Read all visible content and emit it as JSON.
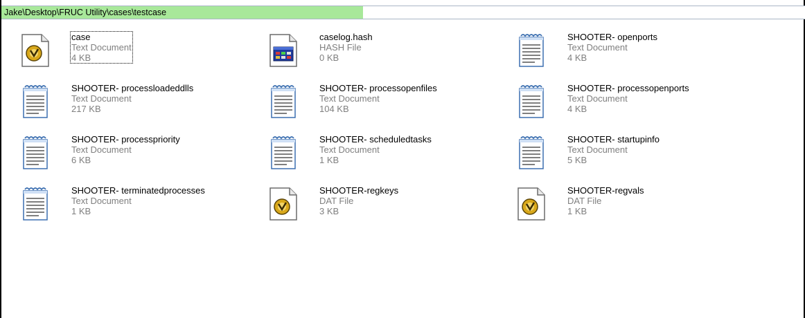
{
  "address_bar": {
    "path": "Jake\\Desktop\\FRUC Utility\\cases\\testcase",
    "progress_percent": 45
  },
  "files": [
    {
      "name": "case",
      "type": "Text Document",
      "size": "4 KB",
      "icon": "ultraedit-icon",
      "focused": true
    },
    {
      "name": "caselog.hash",
      "type": "HASH File",
      "size": "0 KB",
      "icon": "hash-file-icon"
    },
    {
      "name": "SHOOTER- openports",
      "type": "Text Document",
      "size": "4 KB",
      "icon": "notepad-icon"
    },
    {
      "name": "SHOOTER- processloadeddlls",
      "type": "Text Document",
      "size": "217 KB",
      "icon": "notepad-icon"
    },
    {
      "name": "SHOOTER- processopenfiles",
      "type": "Text Document",
      "size": "104 KB",
      "icon": "notepad-icon"
    },
    {
      "name": "SHOOTER- processopenports",
      "type": "Text Document",
      "size": "4 KB",
      "icon": "notepad-icon"
    },
    {
      "name": "SHOOTER- processpriority",
      "type": "Text Document",
      "size": "6 KB",
      "icon": "notepad-icon"
    },
    {
      "name": "SHOOTER- scheduledtasks",
      "type": "Text Document",
      "size": "1 KB",
      "icon": "notepad-icon"
    },
    {
      "name": "SHOOTER- startupinfo",
      "type": "Text Document",
      "size": "5 KB",
      "icon": "notepad-icon"
    },
    {
      "name": "SHOOTER- terminatedprocesses",
      "type": "Text Document",
      "size": "1 KB",
      "icon": "notepad-icon"
    },
    {
      "name": "SHOOTER-regkeys",
      "type": "DAT File",
      "size": "3 KB",
      "icon": "ultraedit-icon"
    },
    {
      "name": "SHOOTER-regvals",
      "type": "DAT File",
      "size": "1 KB",
      "icon": "ultraedit-icon"
    }
  ]
}
